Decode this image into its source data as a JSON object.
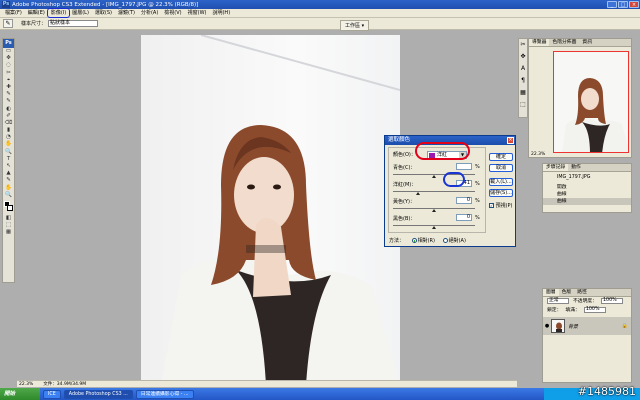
{
  "window": {
    "title": "Adobe Photoshop CS3 Extended - [IMG_1797.JPG @ 22.3% (RGB/8)]",
    "logo": "Ps",
    "controls": {
      "minimize": "_",
      "maximize": "□",
      "close": "×"
    }
  },
  "menubar": [
    "檔案(F)",
    "編輯(E)",
    "影像(I)",
    "圖層(L)",
    "選取(S)",
    "濾鏡(T)",
    "分析(A)",
    "檢視(V)",
    "視窗(W)",
    "說明(H)"
  ],
  "options": {
    "tool_icon": "✎",
    "label": "樣本尺寸：",
    "value": "點狀樣本",
    "workspace": "工作區 ▾"
  },
  "toolbox": {
    "badge": "Ps",
    "tools": [
      "▭",
      "✥",
      "◌",
      "✂",
      "⌖",
      "✚",
      "✎",
      "✎",
      "◐",
      "✐",
      "⌫",
      "▮",
      "◔",
      "✋",
      "🔍",
      "T",
      "↖",
      "▲",
      "✎",
      "✋",
      "🔍",
      "◧",
      "⬚",
      "▦"
    ]
  },
  "dialog": {
    "title": "選取顏色",
    "close": "×",
    "color_label": "顏色(O)：",
    "color_value": "洋紅",
    "rows": [
      {
        "label": "青色(C)：",
        "value": "",
        "unit": "%",
        "thumb": 0.5
      },
      {
        "label": "洋紅(M)：",
        "value": "-41",
        "unit": "%",
        "thumb": 0.3
      },
      {
        "label": "黃色(Y)：",
        "value": "0",
        "unit": "%",
        "thumb": 0.5
      },
      {
        "label": "黑色(B)：",
        "value": "0",
        "unit": "%",
        "thumb": 0.5
      }
    ],
    "buttons": {
      "ok": "確定",
      "cancel": "取消",
      "load": "載入(L)...",
      "save": "儲存(S)..."
    },
    "preview": {
      "label": "預視(P)",
      "checked": true
    },
    "method_label": "方法：",
    "method_relative": "相對(R)",
    "method_absolute": "絕對(A)"
  },
  "navigator": {
    "tabs": [
      "導覽器",
      "色階分佈圖",
      "資訊"
    ],
    "zoom": "22.3%"
  },
  "history": {
    "tabs": [
      "步驟記錄",
      "動作"
    ],
    "items": [
      "IMG_1797.JPG",
      "開啟",
      "曲線",
      "曲線"
    ]
  },
  "layers": {
    "tabs": [
      "圖層",
      "色版",
      "路徑"
    ],
    "blend_mode": "正常",
    "opacity_label": "不透明度：",
    "opacity": "100%",
    "lock_label": "鎖定：",
    "fill_label": "填滿：",
    "fill": "100%",
    "layer_name": "背景"
  },
  "sidestrip": [
    "✂",
    "✥",
    "A",
    "¶",
    "▦",
    "⬚"
  ],
  "status": {
    "zoom": "22.3%",
    "doc": "文件：34.9M/34.9M"
  },
  "taskbar": {
    "start": "開始",
    "tasks": [
      "ICE",
      "Adobe Photoshop CS3 ...",
      "日常連續攝影心得 - ..."
    ]
  },
  "watermark": "#1485981",
  "colors": {
    "annotation_red": "#e3001b",
    "annotation_blue": "#1b35d4",
    "magenta_swatch": "#9c19b0",
    "titlebar": "#1f4fb0"
  }
}
